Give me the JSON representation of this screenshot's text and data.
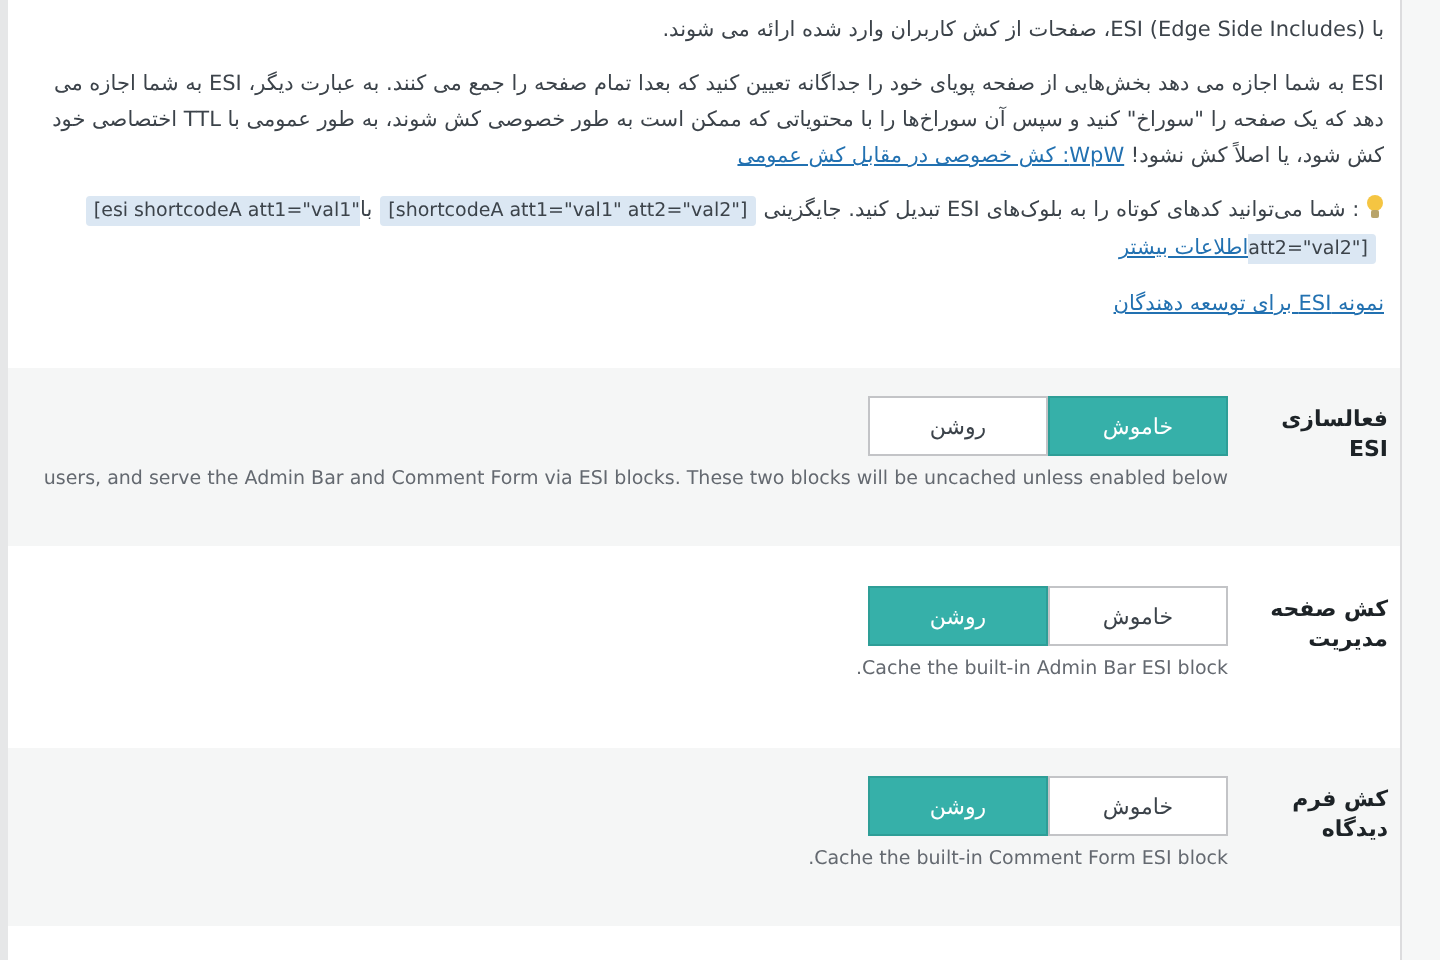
{
  "intro": "با (Edge Side Includes) ESI، صفحات از کش کاربران وارد شده ارائه می شوند.",
  "description": {
    "text": "ESI به شما اجازه می دهد بخش‌هایی از صفحه پویای خود را جداگانه تعیین کنید که بعدا تمام صفحه را جمع می کنند. به عبارت دیگر، ESI به شما اجازه می دهد که یک صفحه را \"سوراخ\" کنید و سپس آن سوراخ‌ها را با محتویاتی که ممکن است به طور خصوصی کش شوند، به طور عمومی با TTL اختصاصی خود کش شود، یا اصلاً کش نشود!",
    "link": "WpW: کش خصوصی در مقابل کش عمومی"
  },
  "hint": {
    "parts": [
      {
        "kind": "text",
        "text": ": شما می‌توانید کدهای کوتاه را به بلوک‌های ESI تبدیل کنید. جایگزینی"
      },
      {
        "kind": "code",
        "text": "[shortcodeA att1=\"val1\" att2=\"val2\"]"
      },
      {
        "kind": "text",
        "text": "با"
      },
      {
        "kind": "code",
        "text": "[esi shortcodeA att1=\"val1\" att2=\"val2\"]"
      },
      {
        "kind": "link",
        "text": "اطلاعات بیشتر"
      }
    ]
  },
  "dev_link": "نمونه ESI برای توسعه دهندگان",
  "settings": [
    {
      "label": "فعالسازی ESI",
      "options": [
        {
          "label": "خاموش",
          "selected": true
        },
        {
          "label": "روشن",
          "selected": false
        }
      ],
      "note": "users, and serve the Admin Bar and Comment Form via ESI blocks. These two blocks will be uncached unless enabled below"
    },
    {
      "label": "کش صفحه مدیریت",
      "options": [
        {
          "label": "خاموش",
          "selected": false
        },
        {
          "label": "روشن",
          "selected": true
        }
      ],
      "note": ".Cache the built-in Admin Bar ESI block"
    },
    {
      "label": "کش فرم دیدگاه",
      "options": [
        {
          "label": "خاموش",
          "selected": false
        },
        {
          "label": "روشن",
          "selected": true
        }
      ],
      "note": ".Cache the built-in Comment Form ESI block"
    }
  ]
}
